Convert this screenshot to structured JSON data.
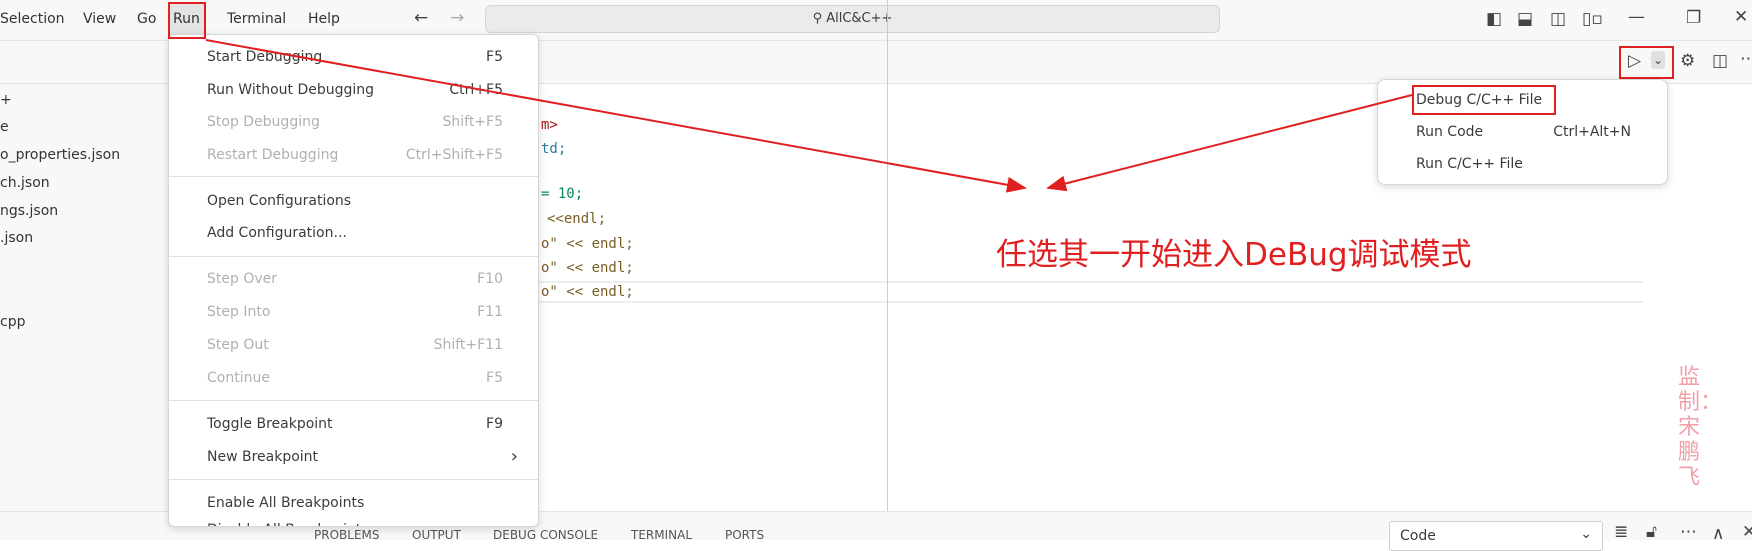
{
  "menubar": {
    "items": [
      "Selection",
      "View",
      "Go",
      "Run",
      "Terminal",
      "Help"
    ]
  },
  "search": {
    "text": "AllC&C++"
  },
  "explorer": {
    "items": [
      "+",
      "e",
      "o_properties.json",
      "ch.json",
      "ngs.json",
      ".json",
      "cpp"
    ]
  },
  "code": {
    "lines": [
      "m>",
      "td;",
      "= 10;",
      "<<endl;",
      "o\" << endl;",
      "o\" << endl;",
      "o\" << endl;"
    ]
  },
  "run_menu": {
    "groups": [
      [
        {
          "label": "Start Debugging",
          "shortcut": "F5",
          "enabled": true
        },
        {
          "label": "Run Without Debugging",
          "shortcut": "Ctrl+F5",
          "enabled": true
        },
        {
          "label": "Stop Debugging",
          "shortcut": "Shift+F5",
          "enabled": false
        },
        {
          "label": "Restart Debugging",
          "shortcut": "Ctrl+Shift+F5",
          "enabled": false
        }
      ],
      [
        {
          "label": "Open Configurations",
          "shortcut": "",
          "enabled": true
        },
        {
          "label": "Add Configuration...",
          "shortcut": "",
          "enabled": true
        }
      ],
      [
        {
          "label": "Step Over",
          "shortcut": "F10",
          "enabled": false
        },
        {
          "label": "Step Into",
          "shortcut": "F11",
          "enabled": false
        },
        {
          "label": "Step Out",
          "shortcut": "Shift+F11",
          "enabled": false
        },
        {
          "label": "Continue",
          "shortcut": "F5",
          "enabled": false
        }
      ],
      [
        {
          "label": "Toggle Breakpoint",
          "shortcut": "F9",
          "enabled": true
        },
        {
          "label": "New Breakpoint",
          "shortcut": "›",
          "enabled": true
        }
      ],
      [
        {
          "label": "Enable All Breakpoints",
          "shortcut": "",
          "enabled": true
        },
        {
          "label": "Disable All Breakpoints",
          "shortcut": "",
          "enabled": true
        }
      ]
    ]
  },
  "run_dropdown": {
    "items": [
      {
        "label": "Debug C/C++ File",
        "shortcut": ""
      },
      {
        "label": "Run Code",
        "shortcut": "Ctrl+Alt+N"
      },
      {
        "label": "Run C/C++ File",
        "shortcut": ""
      }
    ]
  },
  "annotation": {
    "text": "任选其一开始进入DeBug调试模式",
    "color": "#e02020"
  },
  "watermark": {
    "text": "监制：宋鹏飞"
  },
  "panel": {
    "tabs": [
      "PROBLEMS",
      "OUTPUT",
      "DEBUG CONSOLE",
      "TERMINAL",
      "PORTS"
    ],
    "output_select": "Code"
  }
}
